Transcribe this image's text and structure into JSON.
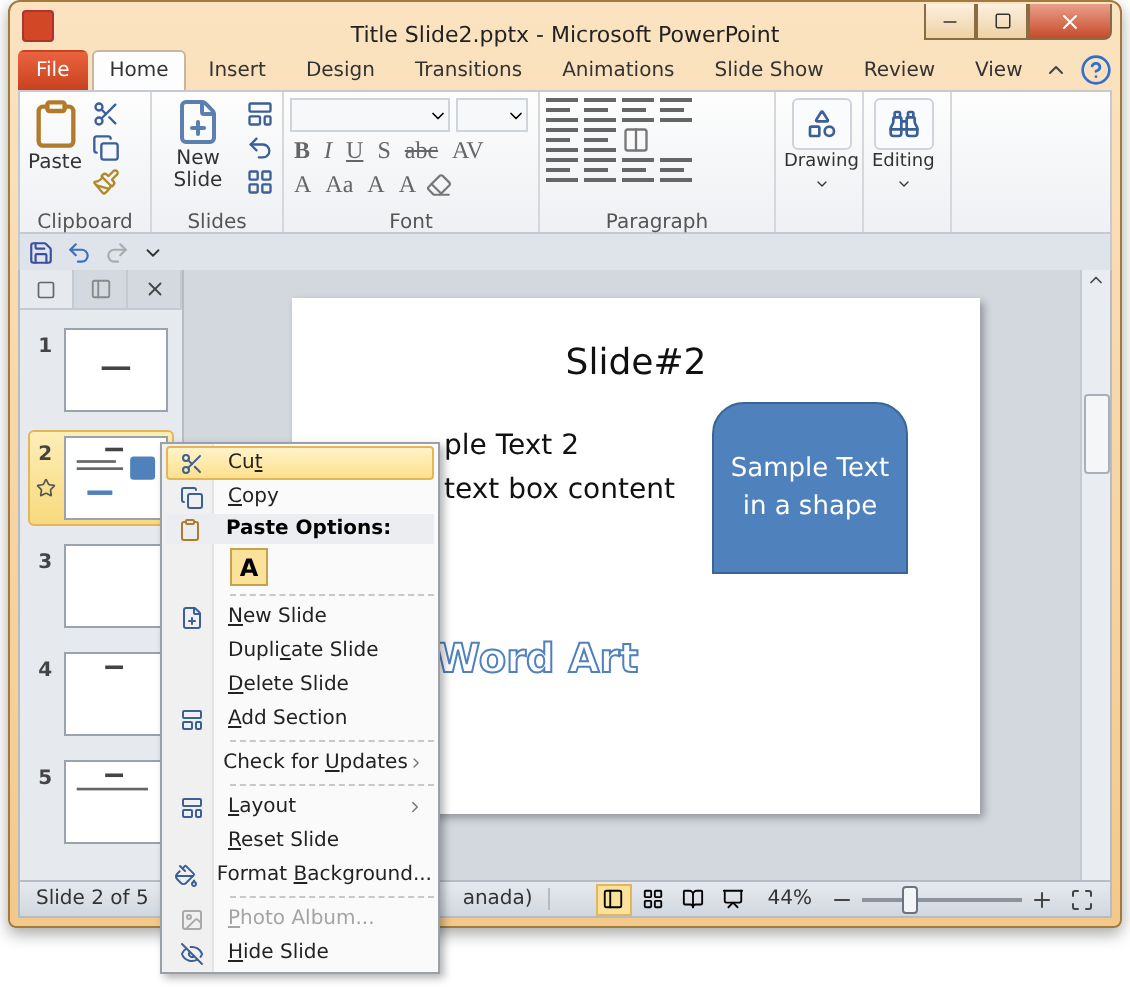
{
  "window": {
    "title": "Title Slide2.pptx  -  Microsoft PowerPoint"
  },
  "tabs": [
    {
      "label": "File",
      "kind": "file",
      "selected": false
    },
    {
      "label": "Home",
      "kind": "tab",
      "selected": true
    },
    {
      "label": "Insert",
      "kind": "tab",
      "selected": false
    },
    {
      "label": "Design",
      "kind": "tab",
      "selected": false
    },
    {
      "label": "Transitions",
      "kind": "tab",
      "selected": false
    },
    {
      "label": "Animations",
      "kind": "tab",
      "selected": false
    },
    {
      "label": "Slide Show",
      "kind": "tab",
      "selected": false
    },
    {
      "label": "Review",
      "kind": "tab",
      "selected": false
    },
    {
      "label": "View",
      "kind": "tab",
      "selected": false
    }
  ],
  "ribbon": {
    "clipboard": {
      "label": "Clipboard",
      "paste": "Paste"
    },
    "slides": {
      "label": "Slides",
      "new_slide": "New Slide"
    },
    "font": {
      "label": "Font",
      "row_1": [
        "B",
        "I",
        "U",
        "S",
        "abc",
        "AV"
      ],
      "row_2": [
        "A",
        "Aa",
        "A",
        "A"
      ]
    },
    "paragraph": {
      "label": "Paragraph"
    },
    "drawing": {
      "label": "Drawing"
    },
    "editing": {
      "label": "Editing"
    }
  },
  "thumbnails": [
    {
      "number": "1",
      "selected": false,
      "transition": false
    },
    {
      "number": "2",
      "selected": true,
      "transition": true
    },
    {
      "number": "3",
      "selected": false,
      "transition": false
    },
    {
      "number": "4",
      "selected": false,
      "transition": false
    },
    {
      "number": "5",
      "selected": false,
      "transition": false
    }
  ],
  "slide": {
    "title": "Slide#2",
    "lines": [
      "ple Text 2",
      "text box content"
    ],
    "shape_text": "Sample Text in a shape",
    "word_art": "Word Art"
  },
  "status_bar": {
    "slide": "Slide 2 of 5",
    "language": "anada)",
    "zoom": "44%",
    "zoom_level": {
      "level": 0.3
    }
  },
  "context_menu": [
    {
      "kind": "item",
      "pre": "Cu",
      "key": "t",
      "selected": true,
      "disabled": false
    },
    {
      "kind": "item",
      "key": "C",
      "post": "opy",
      "selected": false,
      "disabled": false
    },
    {
      "kind": "header",
      "text": "Paste Options:"
    },
    {
      "kind": "paste",
      "text": "A"
    },
    {
      "kind": "separator"
    },
    {
      "kind": "item",
      "key": "N",
      "post": "ew Slide",
      "selected": false,
      "disabled": false
    },
    {
      "kind": "item",
      "pre": "Dupli",
      "key": "c",
      "post": "ate Slide",
      "selected": false,
      "disabled": false
    },
    {
      "kind": "item",
      "key": "D",
      "post": "elete Slide",
      "selected": false,
      "disabled": false
    },
    {
      "kind": "item",
      "key": "A",
      "post": "dd Section",
      "selected": false,
      "disabled": false
    },
    {
      "kind": "separator"
    },
    {
      "kind": "item",
      "pre": "Check for ",
      "key": "U",
      "post": "pdates",
      "submenu": true,
      "selected": false,
      "disabled": false
    },
    {
      "kind": "separator"
    },
    {
      "kind": "item",
      "key": "L",
      "post": "ayout",
      "submenu": true,
      "selected": false,
      "disabled": false
    },
    {
      "kind": "item",
      "key": "R",
      "post": "eset Slide",
      "selected": false,
      "disabled": false
    },
    {
      "kind": "item",
      "pre": "Format ",
      "key": "B",
      "post": "ackground...",
      "selected": false,
      "disabled": false
    },
    {
      "kind": "separator"
    },
    {
      "kind": "item",
      "key": "P",
      "post": "hoto Album...",
      "selected": false,
      "disabled": true
    },
    {
      "kind": "item",
      "key": "H",
      "post": "ide Slide",
      "selected": false,
      "disabled": false
    }
  ]
}
